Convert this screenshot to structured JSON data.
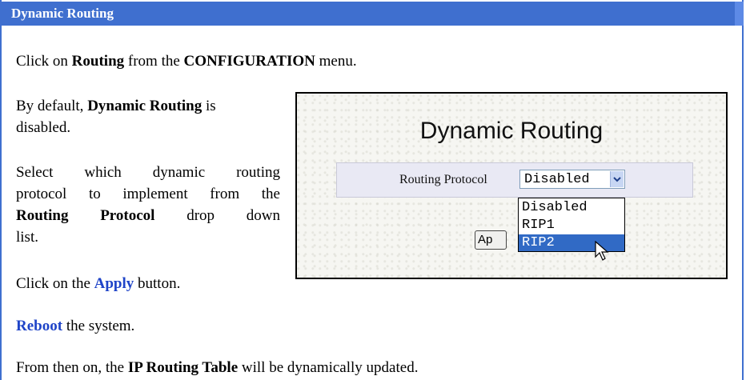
{
  "header": {
    "title": "Dynamic Routing"
  },
  "paragraphs": {
    "p1": {
      "pre": "Click on ",
      "b1": "Routing",
      "mid": " from the ",
      "b2": "CONFIGURATION",
      "post": " menu."
    },
    "p2": {
      "line1_pre": "By default, ",
      "line1_b": "Dynamic Routing",
      "line1_post": " is",
      "line2": "disabled."
    },
    "p3": {
      "line1": "Select which dynamic routing",
      "line2": "protocol to implement from the",
      "line3_b": "Routing Protocol",
      "line3_post": " drop down",
      "line4": "list."
    },
    "p4": {
      "pre": "Click on the ",
      "link": "Apply",
      "post": " button."
    },
    "p5": {
      "link": "Reboot",
      "post": " the system."
    },
    "p6": {
      "pre": "From then on, the ",
      "b": "IP Routing Table",
      "post": " will be dynamically updated."
    }
  },
  "screenshot": {
    "title": "Dynamic Routing",
    "label": "Routing Protocol",
    "selected_value": "Disabled",
    "options": [
      "Disabled",
      "RIP1",
      "RIP2"
    ],
    "highlighted_option": "RIP2",
    "apply_visible": "Ap",
    "colors": {
      "highlight": "#316ac5",
      "header": "#3f6fcf",
      "link": "#1f44c8"
    }
  }
}
